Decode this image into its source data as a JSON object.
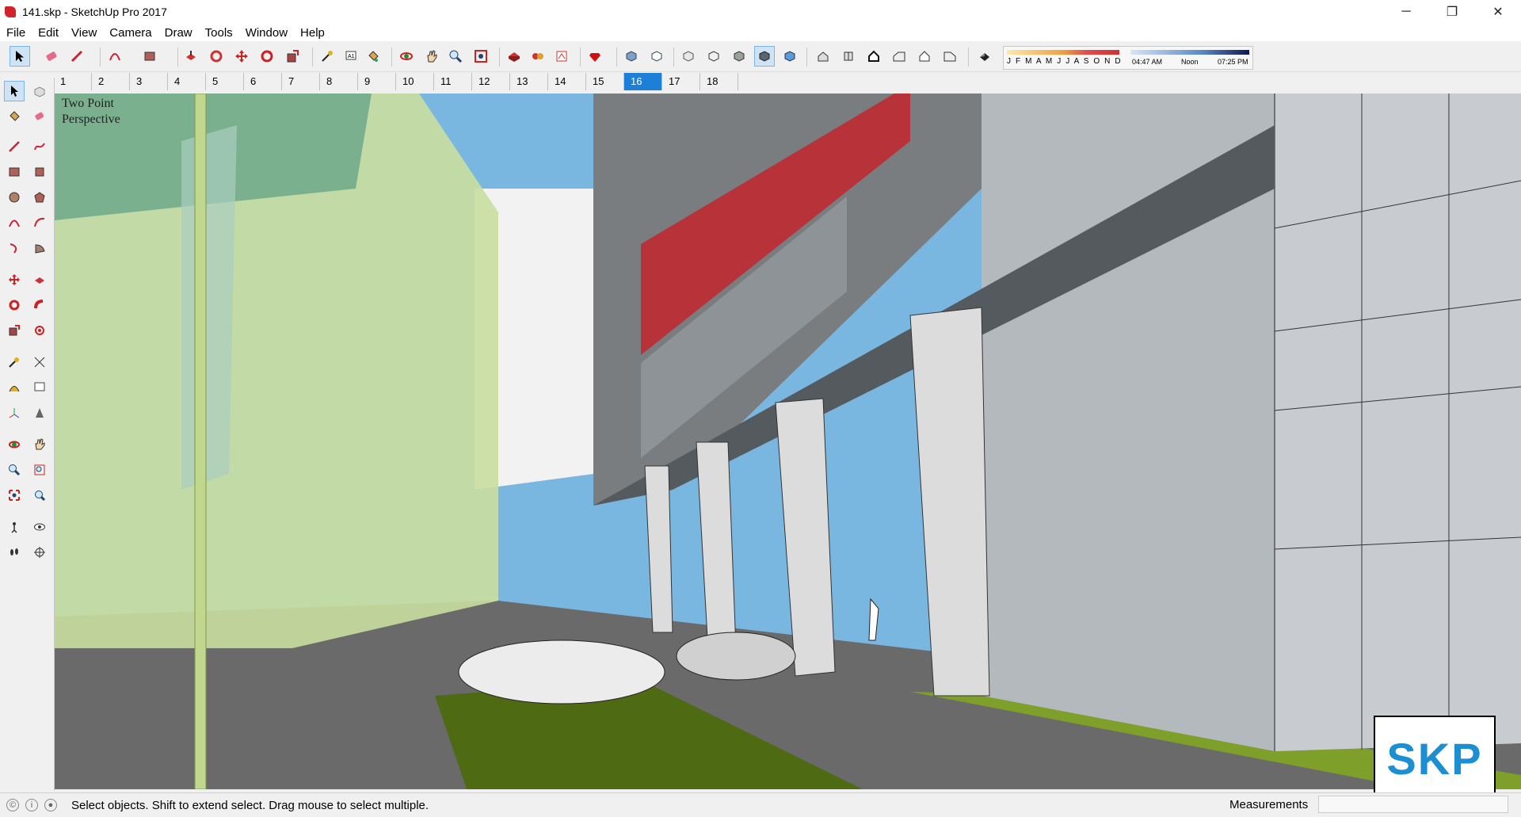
{
  "window": {
    "title": "141.skp - SketchUp Pro 2017",
    "minimize_icon": "minimize-icon",
    "restore_icon": "restore-icon",
    "close_icon": "close-icon"
  },
  "menu": [
    "File",
    "Edit",
    "View",
    "Camera",
    "Draw",
    "Tools",
    "Window",
    "Help"
  ],
  "shadow": {
    "months": "J F M A M J J A S O N D",
    "time_start": "04:47 AM",
    "time_mid": "Noon",
    "time_end": "07:25 PM"
  },
  "scenes": [
    "1",
    "2",
    "3",
    "4",
    "5",
    "6",
    "7",
    "8",
    "9",
    "10",
    "11",
    "12",
    "13",
    "14",
    "15",
    "16",
    "17",
    "18"
  ],
  "active_scene": "16",
  "viewport": {
    "camera_label_line1": "Two Point",
    "camera_label_line2": "Perspective"
  },
  "badge": {
    "text": "SKP"
  },
  "status": {
    "message": "Select objects. Shift to extend select. Drag mouse to select multiple.",
    "measurements_label": "Measurements",
    "measurements_value": ""
  },
  "colors": {
    "accent": "#1e7fd8",
    "sky": "#7ab7e0",
    "grass": "#4e6b14",
    "facade_red": "#b8323a",
    "skp_blue": "#1b8fd1"
  }
}
